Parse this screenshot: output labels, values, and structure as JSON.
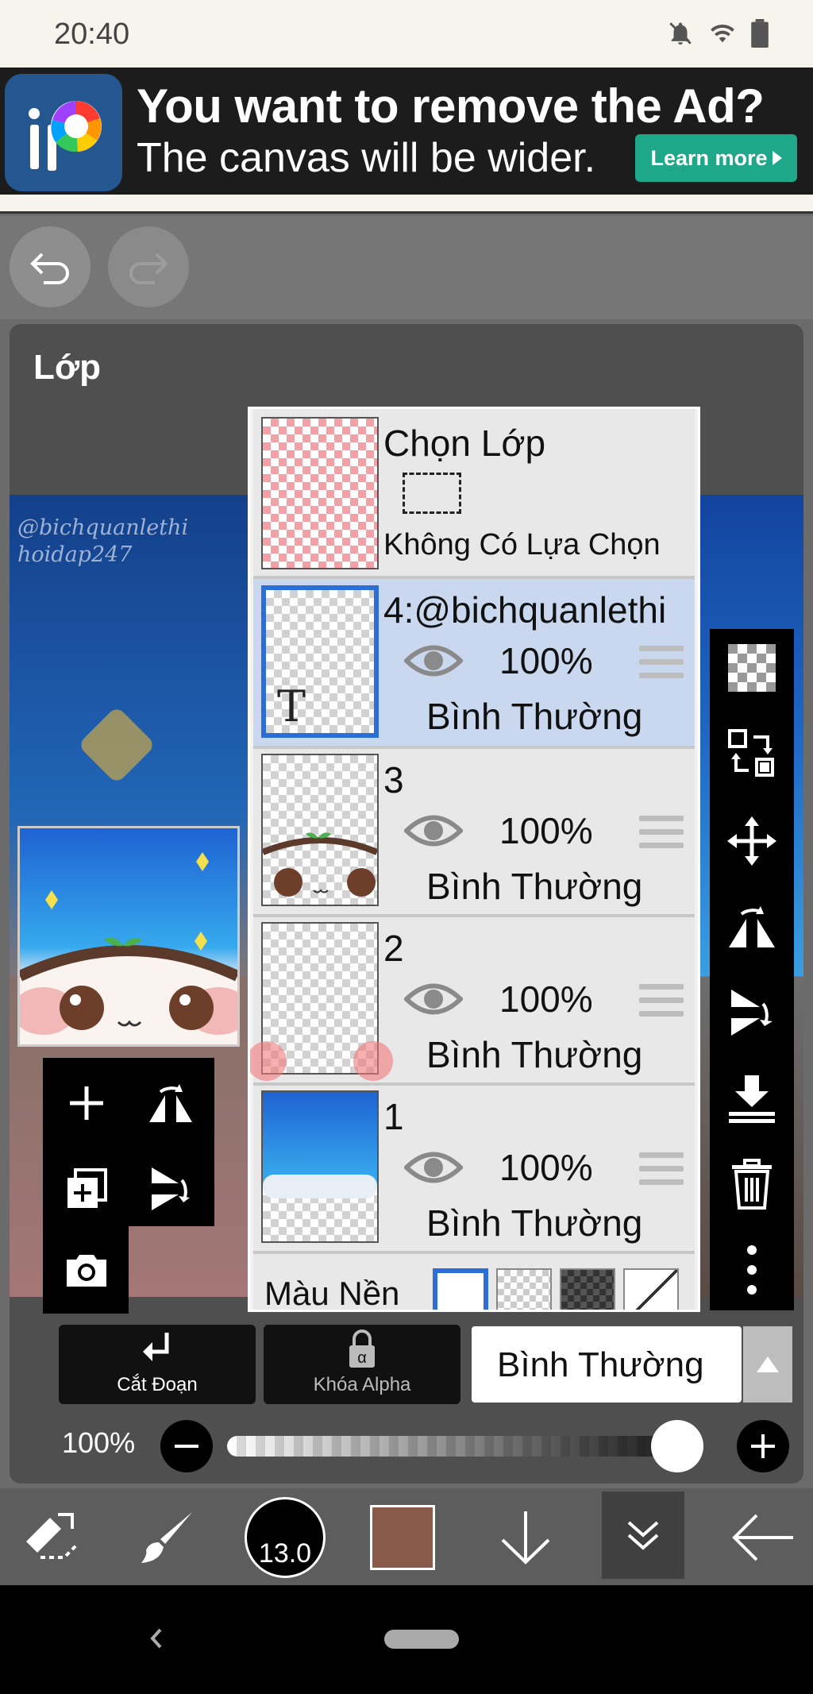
{
  "status_bar": {
    "time": "20:40"
  },
  "ad": {
    "title": "You want to remove the Ad?",
    "subtitle": "The canvas will be wider.",
    "button_label": "Learn more"
  },
  "panel": {
    "title": "Lớp",
    "watermark_line1": "@bichquanlethi",
    "watermark_line2": "hoidap247"
  },
  "layers": {
    "selection": {
      "title": "Chọn Lớp",
      "status": "Không Có Lựa Chọn"
    },
    "items": [
      {
        "name": "4:@bichquanlethi",
        "opacity": "100%",
        "blend": "Bình Thường",
        "selected": true,
        "text_marker": "T"
      },
      {
        "name": "3",
        "opacity": "100%",
        "blend": "Bình Thường",
        "selected": false
      },
      {
        "name": "2",
        "opacity": "100%",
        "blend": "Bình Thường",
        "selected": false
      },
      {
        "name": "1",
        "opacity": "100%",
        "blend": "Bình Thường",
        "selected": false
      }
    ],
    "background_label": "Màu Nền"
  },
  "controls": {
    "clipping_label": "Cắt Đoạn",
    "alpha_lock_label": "Khóa Alpha",
    "blend_mode": "Bình Thường",
    "opacity_label": "100%",
    "opacity_value": 1.0
  },
  "bottom_toolbar": {
    "brush_size": "13.0",
    "color": "#8a5a4a"
  },
  "icons": [
    "bell-off-icon",
    "wifi-icon",
    "battery-icon",
    "undo-icon",
    "redo-icon",
    "add-layer-icon",
    "flip-horizontal-icon",
    "copy-layer-icon",
    "flip-vertical-icon",
    "camera-icon",
    "checker-icon",
    "transfer-icon",
    "move-icon",
    "merge-down-icon",
    "trash-icon",
    "more-icon",
    "eye-icon",
    "drag-handle-icon",
    "back-icon",
    "home-icon"
  ]
}
